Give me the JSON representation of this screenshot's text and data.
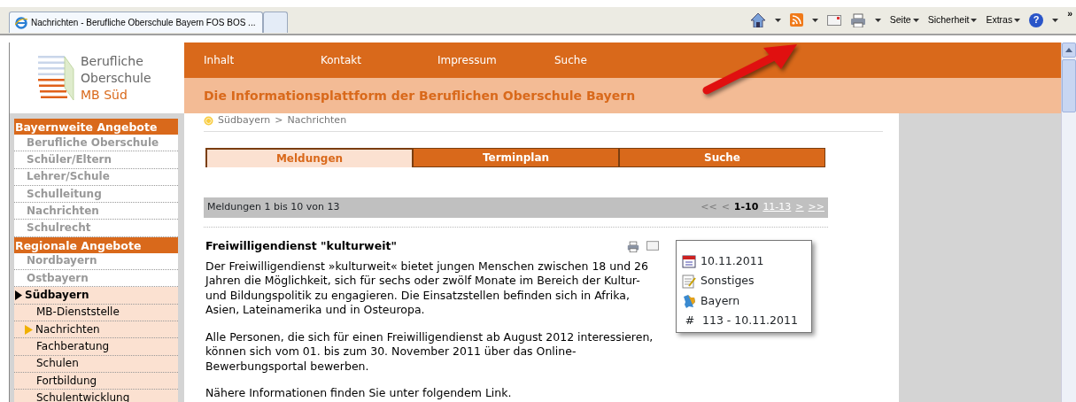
{
  "browser": {
    "tabs": [
      {
        "title": "Nachrichten - Berufliche Oberschule Bayern FOS BOS ...",
        "selected": true
      },
      {
        "selected": false
      }
    ],
    "toolbar": [
      {
        "kind": "home",
        "caret": true
      },
      {
        "kind": "rss",
        "caret": true
      },
      {
        "kind": "mail",
        "caret": false
      },
      {
        "kind": "print",
        "caret": true
      },
      {
        "kind": "menu",
        "label": "Seite",
        "caret": true
      },
      {
        "kind": "menu",
        "label": "Sicherheit",
        "caret": true
      },
      {
        "kind": "menu",
        "label": "Extras",
        "caret": true
      },
      {
        "kind": "help",
        "label": "?",
        "caret": true
      }
    ],
    "overflow": "»"
  },
  "logo": {
    "lines": [
      "Berufliche",
      "Oberschule",
      "MB Süd"
    ]
  },
  "nav": [
    "Inhalt",
    "Kontakt",
    "Impressum",
    "Suche"
  ],
  "site_title": "Die Informationsplattform der Beruflichen Oberschule Bayern",
  "sidebar": [
    {
      "title": "Bayernweite Angebote",
      "items": [
        {
          "label": "Berufliche Oberschule",
          "selected": false
        },
        {
          "label": "Schüler/Eltern",
          "selected": false
        },
        {
          "label": "Lehrer/Schule",
          "selected": false
        },
        {
          "label": "Schulleitung",
          "selected": false
        },
        {
          "label": "Nachrichten",
          "selected": false
        },
        {
          "label": "Schulrecht",
          "selected": false
        }
      ]
    },
    {
      "title": "Regionale Angebote",
      "items": [
        {
          "label": "Nordbayern",
          "selected": false
        },
        {
          "label": "Ostbayern",
          "selected": false
        },
        {
          "label": "Südbayern",
          "selected": true,
          "children": [
            {
              "label": "MB-Dienststelle",
              "selected": false
            },
            {
              "label": "Nachrichten",
              "selected": true
            },
            {
              "label": "Fachberatung",
              "selected": false
            },
            {
              "label": "Schulen",
              "selected": false
            },
            {
              "label": "Fortbildung",
              "selected": false
            },
            {
              "label": "Schulentwicklung",
              "selected": false
            }
          ]
        }
      ]
    }
  ],
  "breadcrumb": {
    "items": [
      "Südbayern",
      "Nachrichten"
    ],
    "separator": ">"
  },
  "tabs": [
    {
      "label": "Meldungen",
      "selected": true
    },
    {
      "label": "Terminplan",
      "selected": false
    },
    {
      "label": "Suche",
      "selected": false
    }
  ],
  "pager": {
    "summary": "Meldungen 1 bis 10 von 13",
    "links": [
      {
        "label": "<<",
        "disabled": true,
        "current": false
      },
      {
        "label": "<",
        "disabled": true,
        "current": false
      },
      {
        "label": "1-10",
        "disabled": false,
        "current": true
      },
      {
        "label": "11-13",
        "disabled": false,
        "current": false
      },
      {
        "label": ">",
        "disabled": false,
        "current": false
      },
      {
        "label": ">>",
        "disabled": false,
        "current": false
      }
    ]
  },
  "article": {
    "title": "Freiwilligendienst \"kulturweit\"",
    "paragraphs": [
      "Der Freiwilligendienst »kulturweit« bietet jungen Menschen zwischen 18 und 26 Jahren die Möglichkeit, sich für sechs oder zwölf Monate im Bereich der Kultur- und Bildungspolitik zu engagieren. Die Einsatzstellen befinden sich in Afrika, Asien, Lateinamerika und in Osteuropa.",
      "Alle Personen, die sich für einen Freiwilligendienst ab August 2012 interessieren, können sich vom 01. bis zum 30. November 2011 über das Online-Bewerbungsportal bewerben.",
      "Nähere Informationen finden Sie unter folgendem Link."
    ],
    "meta": [
      {
        "kind": "date",
        "text": "10.11.2011"
      },
      {
        "kind": "category",
        "text": "Sonstiges"
      },
      {
        "kind": "region",
        "text": "Bayern"
      },
      {
        "kind": "number",
        "symbol": "#",
        "text": "113 - 10.11.2011"
      }
    ]
  }
}
